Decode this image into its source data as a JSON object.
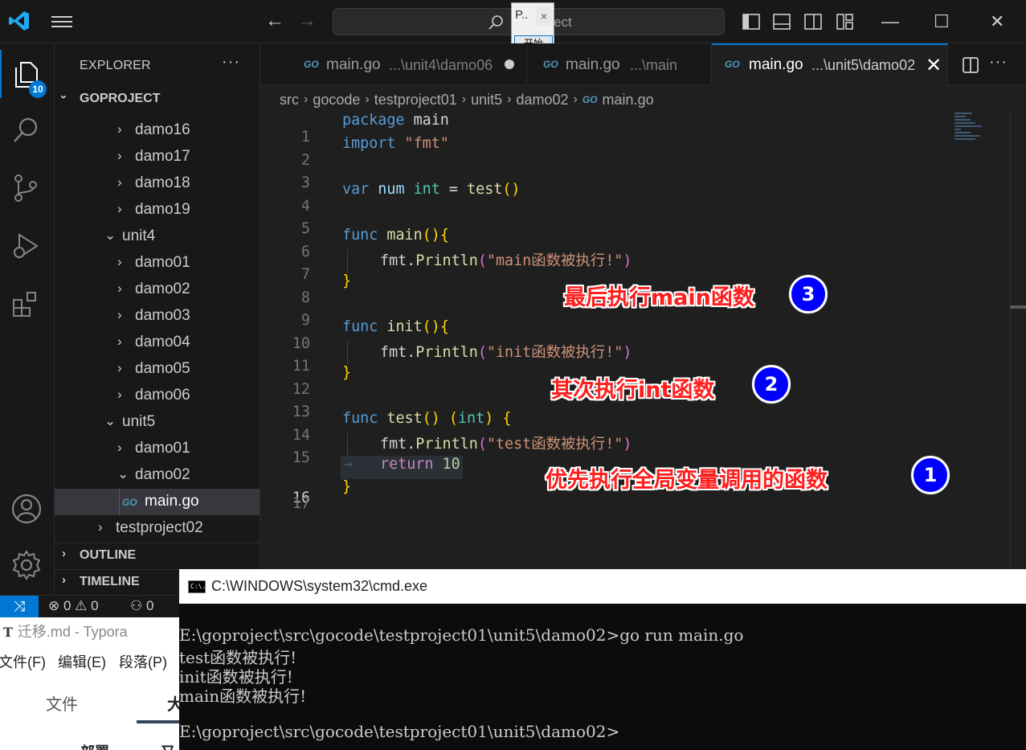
{
  "titlebar": {
    "command_center_text": "ect",
    "popup_title": "P..",
    "popup_close": "×",
    "popup_button": "开始",
    "back_arrow": "←",
    "forward_arrow": "→",
    "minimize": "—",
    "maximize": "☐",
    "close": "✕"
  },
  "activitybar": {
    "explorer_badge": "10"
  },
  "sidebar": {
    "title": "EXPLORER",
    "more": "···",
    "project": "GOPROJECT",
    "tree": [
      {
        "label": "damo16",
        "chevron": "›"
      },
      {
        "label": "damo17",
        "chevron": "›"
      },
      {
        "label": "damo18",
        "chevron": "›"
      },
      {
        "label": "damo19",
        "chevron": "›"
      },
      {
        "label": "unit4",
        "chevron": "⌄"
      },
      {
        "label": "damo01",
        "chevron": "›"
      },
      {
        "label": "damo02",
        "chevron": "›"
      },
      {
        "label": "damo03",
        "chevron": "›"
      },
      {
        "label": "damo04",
        "chevron": "›"
      },
      {
        "label": "damo05",
        "chevron": "›"
      },
      {
        "label": "damo06",
        "chevron": "›"
      },
      {
        "label": "unit5",
        "chevron": "⌄"
      },
      {
        "label": "damo01",
        "chevron": "›"
      },
      {
        "label": "damo02",
        "chevron": "⌄"
      },
      {
        "label": "main.go",
        "chevron": ""
      },
      {
        "label": "testproject02",
        "chevron": "›"
      }
    ],
    "go_badge": "GO",
    "outline": "OUTLINE",
    "timeline": "TIMELINE",
    "section_chevron": "›"
  },
  "tabs": [
    {
      "name": "main.go",
      "path": "...\\unit4\\damo06",
      "modified": true
    },
    {
      "name": "main.go",
      "path": "...\\main",
      "modified": false
    },
    {
      "name": "main.go",
      "path": "...\\unit5\\damo02",
      "active": true,
      "close": "✕"
    }
  ],
  "editor_more": "···",
  "breadcrumb": [
    "src",
    "gocode",
    "testproject01",
    "unit5",
    "damo02",
    "main.go"
  ],
  "breadcrumb_sep": "›",
  "code": {
    "line_numbers": [
      "1",
      "2",
      "3",
      "4",
      "5",
      "6",
      "7",
      "8",
      "9",
      "10",
      "11",
      "12",
      "13",
      "14",
      "15",
      "16",
      "17"
    ],
    "l1_kw": "package",
    "l1_name": "main",
    "l2_kw": "import",
    "l2_str": "\"fmt\"",
    "l4_kw": "var",
    "l4_var": "num",
    "l4_type": "int",
    "l4_eq": "=",
    "l4_fn": "test",
    "l4_paren": "()",
    "l6_kw": "func",
    "l6_fn": "main",
    "l6_paren": "()",
    "l6_brace": "{",
    "l7_pkg": "fmt",
    "l7_dot": ".",
    "l7_fn": "Println",
    "l7_open": "(",
    "l7_str": "\"main函数被执行!\"",
    "l7_close": ")",
    "l8_brace": "}",
    "l10_kw": "func",
    "l10_fn": "init",
    "l10_paren": "()",
    "l10_brace": "{",
    "l11_pkg": "fmt",
    "l11_dot": ".",
    "l11_fn": "Println",
    "l11_open": "(",
    "l11_str": "\"init函数被执行!\"",
    "l11_close": ")",
    "l12_brace": "}",
    "l14_kw": "func",
    "l14_fn": "test",
    "l14_paren": "()",
    "l14_open": "(",
    "l14_type": "int",
    "l14_close": ")",
    "l14_brace": "{",
    "l15_pkg": "fmt",
    "l15_dot": ".",
    "l15_fn": "Println",
    "l15_open": "(",
    "l15_str": "\"test函数被执行!\"",
    "l15_close": ")",
    "l16_arrow": "→",
    "l16_kw": "return",
    "l16_num": "10",
    "l17_brace": "}"
  },
  "annotations": [
    {
      "text": "最后执行main函数",
      "number": "3"
    },
    {
      "text": "其次执行int函数",
      "number": "2"
    },
    {
      "text": "优先执行全局变量调用的函数",
      "number": "1"
    }
  ],
  "statusbar": {
    "remote": "⤨",
    "problems": "⊗ 0 ⚠ 0",
    "ports": "⚇ 0"
  },
  "typora": {
    "icon": "T",
    "title": "迁移.md - Typora",
    "menu": [
      "文件(F)",
      "编辑(E)",
      "段落(P)"
    ],
    "file_tab": "文件",
    "tab2": "大",
    "bottom1": "部署",
    "bottom2": "又"
  },
  "cmd": {
    "title": "C:\\WINDOWS\\system32\\cmd.exe",
    "icon": "C:\\.",
    "lines": [
      "E:\\goproject\\src\\gocode\\testproject01\\unit5\\damo02>go run main.go",
      "test函数被执行!",
      "init函数被执行!",
      "main函数被执行!",
      "",
      "E:\\goproject\\src\\gocode\\testproject01\\unit5\\damo02>"
    ]
  },
  "colors": {
    "accent": "#0078d4",
    "annotation_text": "#ff1e1e",
    "annotation_circle": "#0000ff"
  }
}
